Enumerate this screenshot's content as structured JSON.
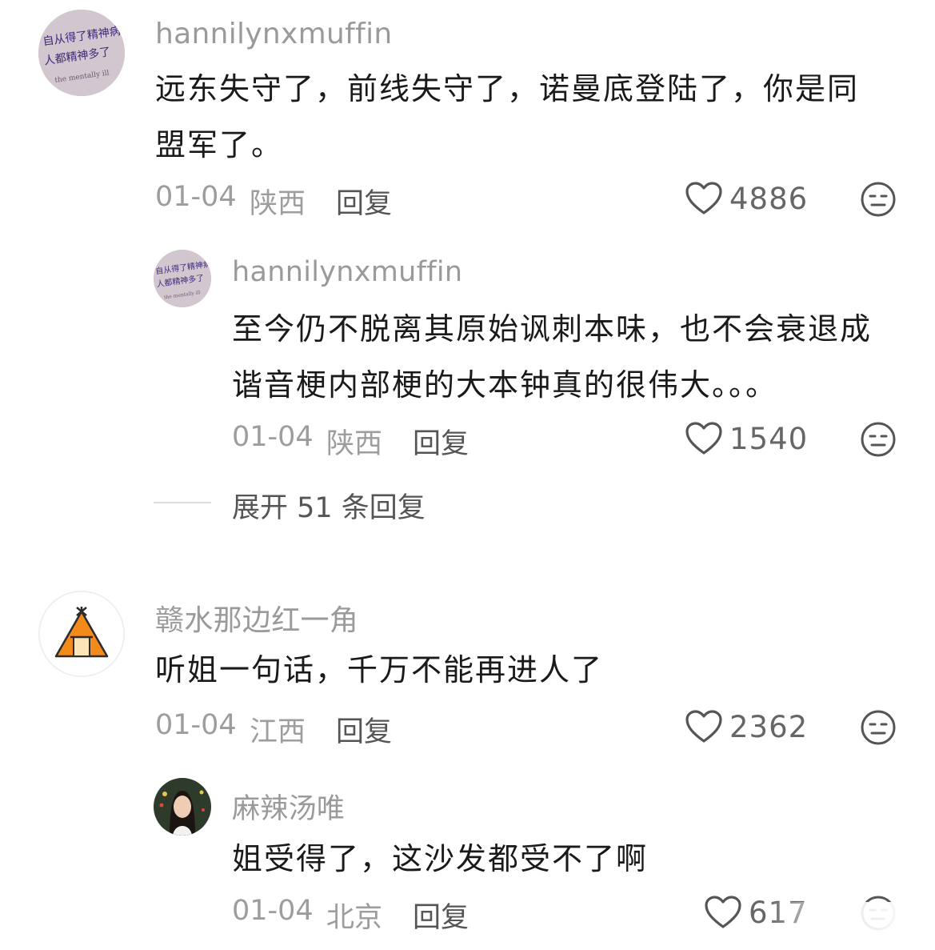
{
  "comments": [
    {
      "username": "hannilynxmuffin",
      "text_line1": "远东失守了，前线失守了，诺曼底登陆了，你是同",
      "text_line2": "盟军了。",
      "date": "01-04",
      "location": "陕西",
      "reply_label": "回复",
      "likes": "4886",
      "avatar_icon": "poster-photo-avatar",
      "avatar_text1": "自从得了精神病",
      "avatar_text2": "人都精神多了",
      "avatar_text3": "the mentally ill"
    },
    {
      "username": "hannilynxmuffin",
      "text_line1": "至今仍不脱离其原始讽刺本味，也不会衰退成",
      "text_line2": "谐音梗内部梗的大本钟真的很伟大。。。",
      "date": "01-04",
      "location": "陕西",
      "reply_label": "回复",
      "likes": "1540",
      "avatar_icon": "poster-photo-avatar",
      "avatar_text1": "自从得了精神病",
      "avatar_text2": "人都精神多了",
      "avatar_text3": "the mentally ill"
    },
    {
      "username": "赣水那边红一角",
      "text_line1": "听姐一句话，千万不能再进人了",
      "date": "01-04",
      "location": "江西",
      "reply_label": "回复",
      "likes": "2362",
      "avatar_icon": "tent-icon"
    },
    {
      "username": "麻辣汤唯",
      "text_line1": "姐受得了，这沙发都受不了啊",
      "date": "01-04",
      "location": "北京",
      "reply_label": "回复",
      "likes": "617",
      "avatar_icon": "portrait-photo-avatar"
    }
  ],
  "expand_replies": "展开 51 条回复",
  "colors": {
    "username": "#9a9a9a",
    "meta": "#9d9d9d",
    "text": "#1a1a1a",
    "tent_orange": "#f28a1c"
  }
}
